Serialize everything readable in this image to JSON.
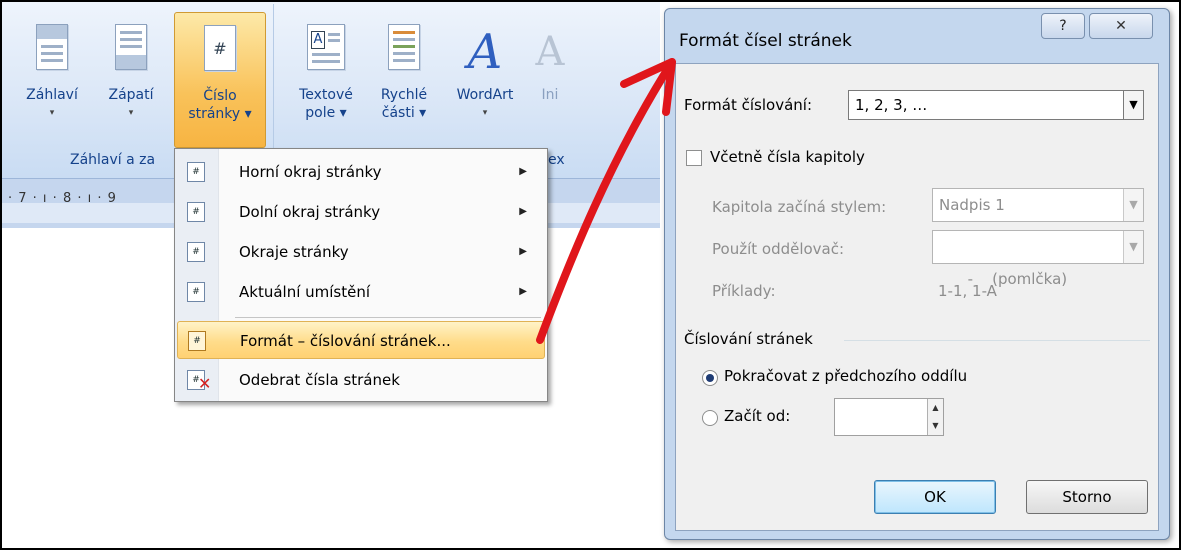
{
  "ribbon": {
    "buttons": [
      {
        "label_line1": "Záhlaví",
        "label_line2": "▾"
      },
      {
        "label_line1": "Zápatí",
        "label_line2": "▾"
      },
      {
        "label_line1": "Číslo",
        "label_line2": "stránky ▾"
      },
      {
        "label_line1": "Textové",
        "label_line2": "pole ▾"
      },
      {
        "label_line1": "Rychlé",
        "label_line2": "části ▾"
      },
      {
        "label_line1": "WordArt",
        "label_line2": "▾"
      },
      {
        "label_line1": "Ini",
        "label_line2": ""
      }
    ],
    "group_label": "Záhlaví a za",
    "group2_label_fragment": "ex",
    "ruler_text": "· 7 · ı · 8 · ı · 9"
  },
  "menu": {
    "items": [
      {
        "label": "Horní okraj stránky",
        "submenu": true
      },
      {
        "label": "Dolní okraj stránky",
        "submenu": true
      },
      {
        "label": "Okraje stránky",
        "submenu": true
      },
      {
        "label": "Aktuální umístění",
        "submenu": true
      },
      {
        "label": "Formát – číslování stránek...",
        "submenu": false,
        "highlighted": true
      },
      {
        "label": "Odebrat čísla stránek",
        "submenu": false
      }
    ]
  },
  "dialog": {
    "title": "Formát čísel stránek",
    "help_glyph": "?",
    "close_glyph": "✕",
    "number_format_label": "Formát číslování:",
    "number_format_value": "1, 2, 3, …",
    "include_chapter_label": "Včetně čísla kapitoly",
    "chapter_starts_label": "Kapitola začíná stylem:",
    "chapter_starts_value": "Nadpis 1",
    "separator_label": "Použít oddělovač:",
    "separator_value": "-    (pomlčka)",
    "examples_label": "Příklady:",
    "examples_value": "1-1, 1-A",
    "page_numbering_heading": "Číslování stránek",
    "continue_label": "Pokračovat z předchozího oddílu",
    "start_at_label": "Začít od:",
    "start_at_value": "",
    "ok_label": "OK",
    "cancel_label": "Storno"
  },
  "colors": {
    "ribbon_text": "#15428b",
    "menu_highlight": "#ffdc8a",
    "annotation_arrow": "#e0161b",
    "dialog_frame": "#c4d7ee"
  }
}
